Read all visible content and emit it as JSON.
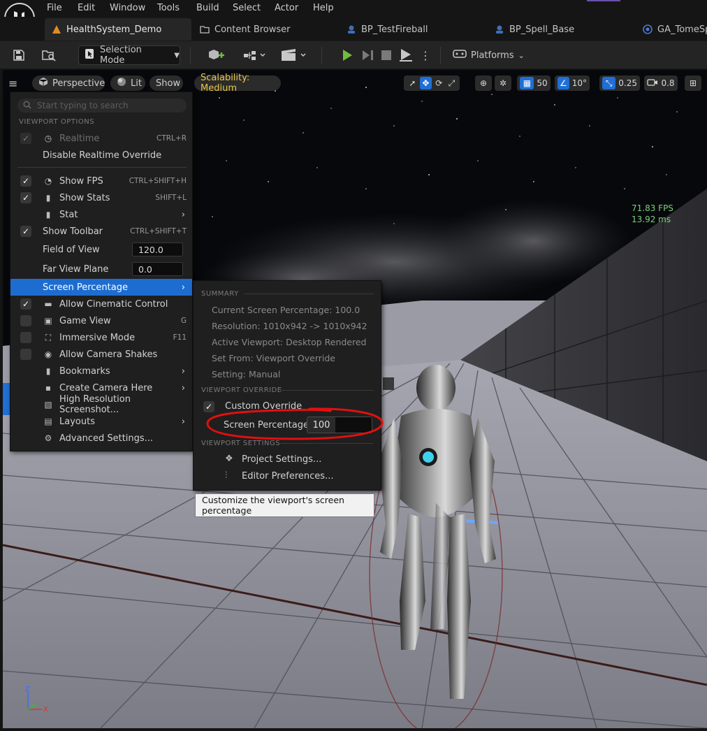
{
  "menubar": {
    "items": [
      "File",
      "Edit",
      "Window",
      "Tools",
      "Build",
      "Select",
      "Actor",
      "Help"
    ]
  },
  "tabs": [
    {
      "label": "HealthSystem_Demo",
      "icon": "level-icon",
      "active": true
    },
    {
      "label": "Content Browser",
      "icon": "folder-icon",
      "active": false
    },
    {
      "label": "BP_TestFireball",
      "icon": "blueprint-icon",
      "active": false
    },
    {
      "label": "BP_Spell_Base",
      "icon": "blueprint-icon",
      "active": false
    },
    {
      "label": "GA_TomeSp",
      "icon": "ability-icon",
      "active": false
    }
  ],
  "toolbar": {
    "selection_mode": "Selection Mode",
    "platforms": "Platforms"
  },
  "viewport_bar": {
    "perspective": "Perspective",
    "lit": "Lit",
    "show": "Show",
    "scalability": "Scalability: Medium",
    "grid_size": "50",
    "rotation_snap": "10°",
    "scale_snap": "0.25",
    "camera_speed": "0.8"
  },
  "stats": {
    "fps": "71.83 FPS",
    "ms": "13.92 ms"
  },
  "viewport_menu": {
    "search_placeholder": "Start typing to search",
    "section_viewport_options": "VIEWPORT OPTIONS",
    "items": [
      {
        "label": "Realtime",
        "shortcut": "CTRL+R",
        "checked": true,
        "disabled": true
      },
      {
        "label": "Disable Realtime Override"
      },
      {
        "label": "Show FPS",
        "shortcut": "CTRL+SHIFT+H",
        "checked": true
      },
      {
        "label": "Show Stats",
        "shortcut": "SHIFT+L",
        "checked": true
      },
      {
        "label": "Stat"
      },
      {
        "label": "Show Toolbar",
        "shortcut": "CTRL+SHIFT+T",
        "checked": true
      },
      {
        "label": "Field of View",
        "value": "120.0"
      },
      {
        "label": "Far View Plane",
        "value": "0.0"
      },
      {
        "label": "Screen Percentage"
      },
      {
        "label": "Allow Cinematic Control",
        "checked": true
      },
      {
        "label": "Game View",
        "shortcut": "G",
        "checked": false
      },
      {
        "label": "Immersive Mode",
        "shortcut": "F11",
        "checked": false
      },
      {
        "label": "Allow Camera Shakes",
        "checked": false
      },
      {
        "label": "Bookmarks"
      },
      {
        "label": "Create Camera Here"
      },
      {
        "label": "High Resolution Screenshot..."
      },
      {
        "label": "Layouts"
      },
      {
        "label": "Advanced Settings..."
      }
    ]
  },
  "screen_percentage_menu": {
    "section_summary": "SUMMARY",
    "summary": [
      "Current Screen Percentage: 100.0",
      "Resolution: 1010x942 -> 1010x942",
      "Active Viewport: Desktop Rendered",
      "Set From: Viewport Override",
      "Setting: Manual"
    ],
    "section_override": "VIEWPORT OVERRIDE",
    "custom_override": "Custom Override",
    "custom_override_checked": true,
    "screen_percentage_label": "Screen Percentage",
    "screen_percentage_value": "100",
    "section_settings": "VIEWPORT SETTINGS",
    "project_settings": "Project Settings...",
    "editor_preferences": "Editor Preferences..."
  },
  "tooltip": "Customize the viewport's screen percentage",
  "colors": {
    "accent": "#1d6dd1",
    "scalability": "#e8c547",
    "fps": "#7ed07a",
    "play": "#6fbf3a",
    "annotation": "#e01010"
  }
}
